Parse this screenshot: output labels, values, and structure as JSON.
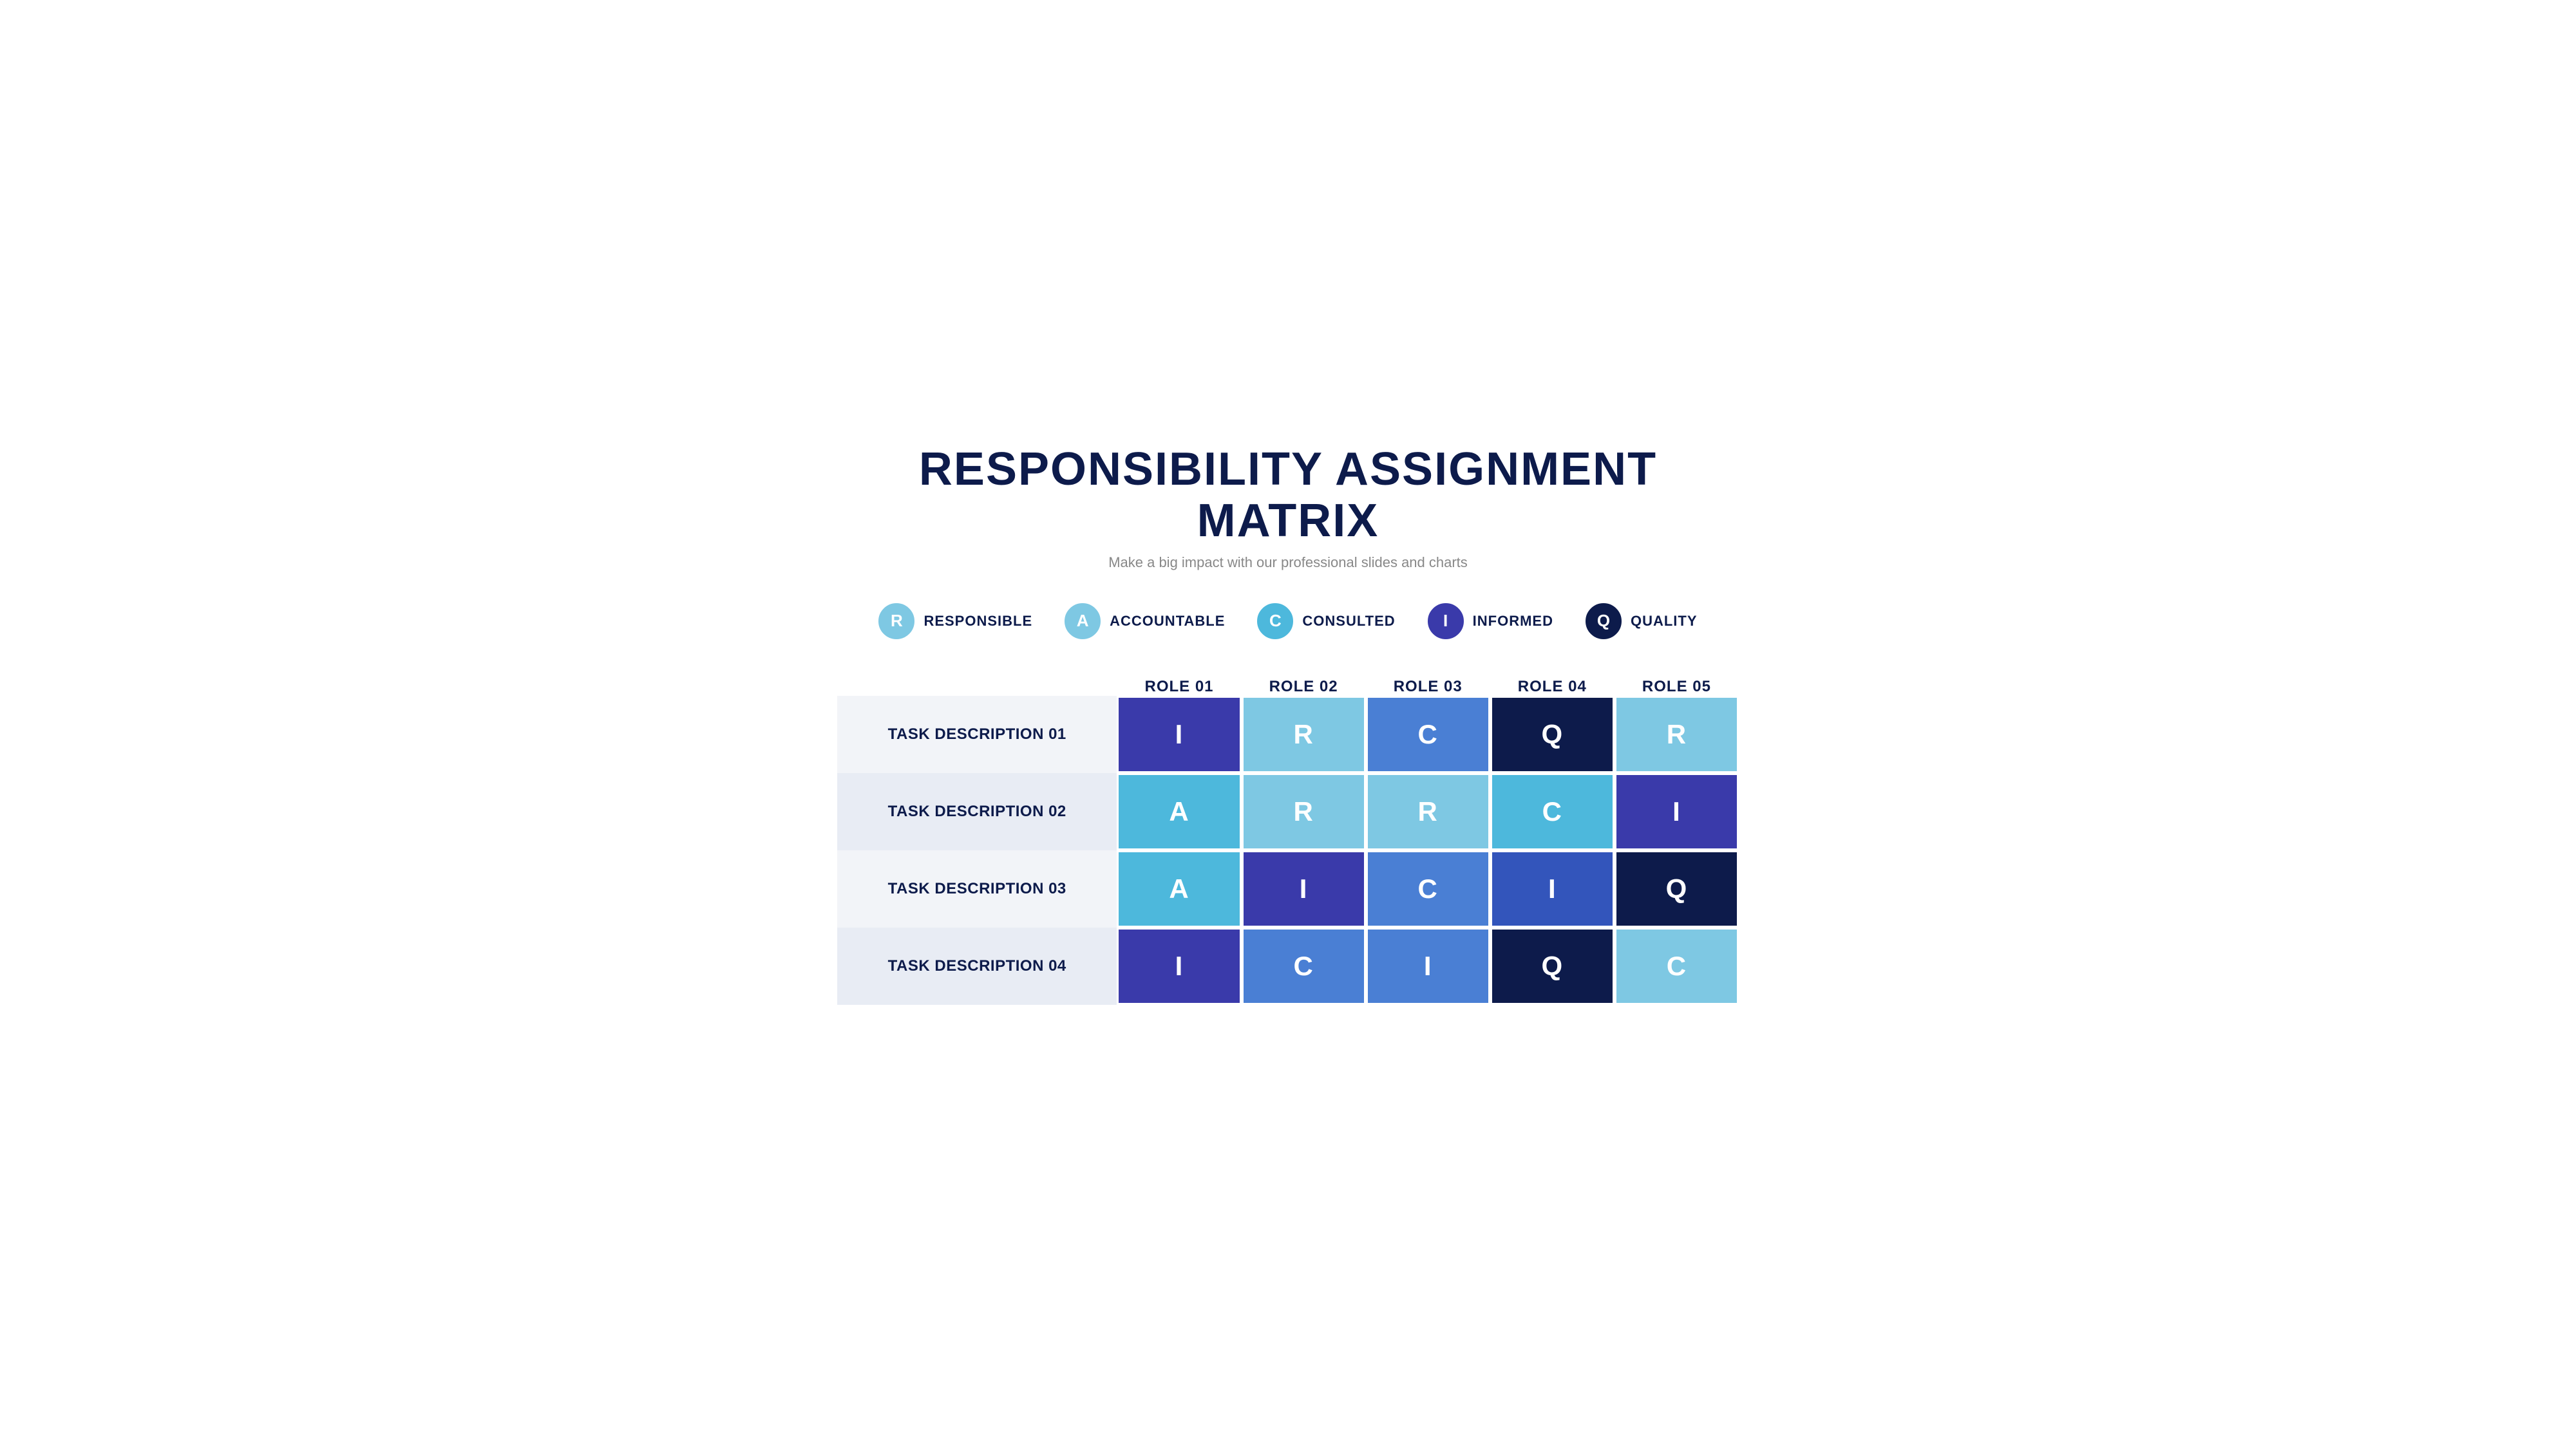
{
  "title": "RESPONSIBILITY ASSIGNMENT MATRIX",
  "subtitle": "Make a big impact with our professional slides and charts",
  "legend": [
    {
      "key": "responsible",
      "letter": "R",
      "label": "RESPONSIBLE",
      "colorClass": "responsible"
    },
    {
      "key": "accountable",
      "letter": "A",
      "label": "ACCOUNTABLE",
      "colorClass": "accountable"
    },
    {
      "key": "consulted",
      "letter": "C",
      "label": "CONSULTED",
      "colorClass": "consulted"
    },
    {
      "key": "informed",
      "letter": "I",
      "label": "INFORMED",
      "colorClass": "informed"
    },
    {
      "key": "quality",
      "letter": "Q",
      "label": "QUALITY",
      "colorClass": "quality"
    }
  ],
  "columns": [
    "ROLE 01",
    "ROLE 02",
    "ROLE 03",
    "ROLE 04",
    "ROLE 05"
  ],
  "rows": [
    {
      "label": "TASK DESCRIPTION 01",
      "cells": [
        {
          "letter": "I",
          "colorClass": "cell-blue-dark"
        },
        {
          "letter": "R",
          "colorClass": "cell-cyan-light"
        },
        {
          "letter": "C",
          "colorClass": "cell-blue-medium"
        },
        {
          "letter": "Q",
          "colorClass": "cell-navy"
        },
        {
          "letter": "R",
          "colorClass": "cell-cyan-light"
        }
      ]
    },
    {
      "label": "TASK DESCRIPTION 02",
      "cells": [
        {
          "letter": "A",
          "colorClass": "cell-cyan-medium"
        },
        {
          "letter": "R",
          "colorClass": "cell-cyan-light"
        },
        {
          "letter": "R",
          "colorClass": "cell-cyan-light"
        },
        {
          "letter": "C",
          "colorClass": "cell-cyan-medium"
        },
        {
          "letter": "I",
          "colorClass": "cell-blue-dark"
        }
      ]
    },
    {
      "label": "TASK DESCRIPTION 03",
      "cells": [
        {
          "letter": "A",
          "colorClass": "cell-cyan-medium"
        },
        {
          "letter": "I",
          "colorClass": "cell-blue-dark"
        },
        {
          "letter": "C",
          "colorClass": "cell-blue-medium"
        },
        {
          "letter": "I",
          "colorClass": "cell-blue-royal"
        },
        {
          "letter": "Q",
          "colorClass": "cell-navy"
        }
      ]
    },
    {
      "label": "TASK DESCRIPTION 04",
      "cells": [
        {
          "letter": "I",
          "colorClass": "cell-blue-dark"
        },
        {
          "letter": "C",
          "colorClass": "cell-blue-medium"
        },
        {
          "letter": "I",
          "colorClass": "cell-blue-medium"
        },
        {
          "letter": "Q",
          "colorClass": "cell-navy"
        },
        {
          "letter": "C",
          "colorClass": "cell-cyan-light"
        }
      ]
    }
  ]
}
